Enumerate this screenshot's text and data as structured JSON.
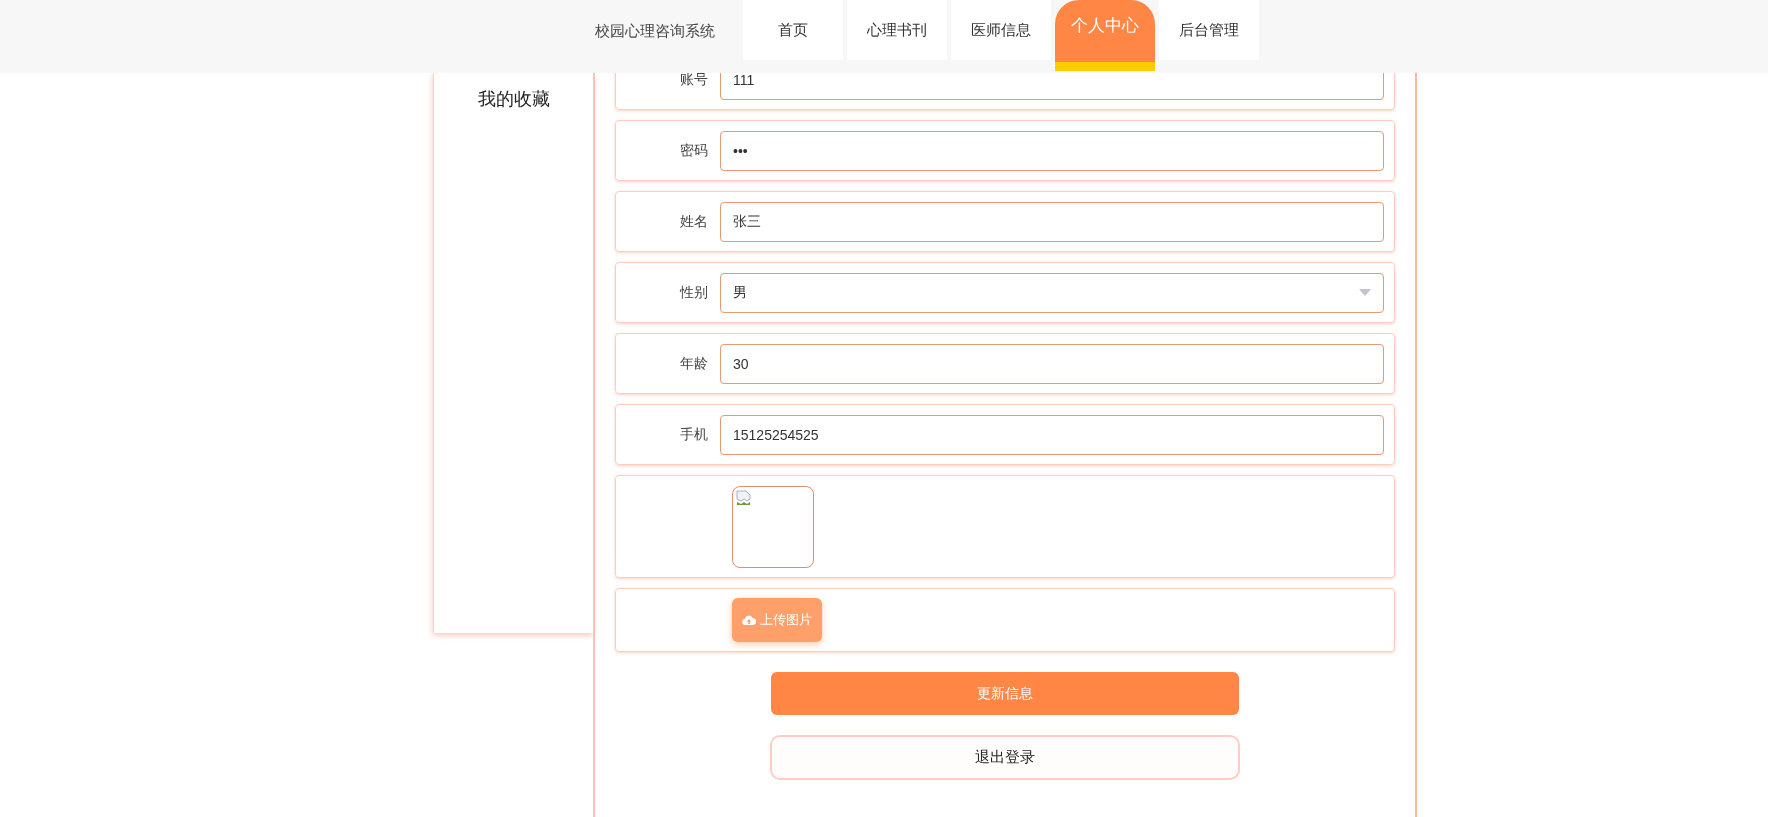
{
  "header": {
    "title": "校园心理咨询系统",
    "nav": [
      {
        "label": "首页",
        "selected": false
      },
      {
        "label": "心理书刊",
        "selected": false
      },
      {
        "label": "医师信息",
        "selected": false
      },
      {
        "label": "个人中心",
        "selected": true
      },
      {
        "label": "后台管理",
        "selected": false
      }
    ]
  },
  "sidebar": {
    "items": [
      {
        "label": "我的收藏"
      }
    ]
  },
  "form": {
    "fields": [
      {
        "label": "账号",
        "kind": "text",
        "value": "111"
      },
      {
        "label": "密码",
        "kind": "password",
        "value": "•••"
      },
      {
        "label": "姓名",
        "kind": "text",
        "value": "张三"
      },
      {
        "label": "性别",
        "kind": "select",
        "value": "男"
      },
      {
        "label": "年龄",
        "kind": "text",
        "value": "30"
      },
      {
        "label": "手机",
        "kind": "text",
        "value": "15125254525"
      }
    ],
    "upload_button": "上传图片",
    "submit_button": "更新信息",
    "logout_button": "退出登录"
  }
}
